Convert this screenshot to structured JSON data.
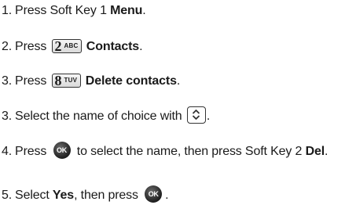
{
  "steps": [
    {
      "num": "1.",
      "pre": "Press Soft Key 1 ",
      "bold": "Menu",
      "post": "."
    },
    {
      "num": "2.",
      "pre": "Press ",
      "key_big": "2",
      "key_small": "ABC",
      "bold": "Contacts",
      "post": "."
    },
    {
      "num": "3.",
      "pre": "Press ",
      "key_big": "8",
      "key_small": "TUV",
      "bold": "Delete contacts",
      "post": "."
    },
    {
      "num": "3.",
      "pre": "Select the name of choice with ",
      "post": "."
    },
    {
      "num": "4.",
      "pre": "Press ",
      "mid": "to select the name, then press Soft Key 2 ",
      "bold": "Del",
      "post": "."
    },
    {
      "num": "5.",
      "pre": "Select ",
      "bold": "Yes",
      "mid": ", then press ",
      "post": "."
    }
  ],
  "icons": {
    "ok_label": "OK",
    "key_2": "2-abc-key-icon",
    "key_8": "8-tuv-key-icon",
    "nav": "navigation-key-icon",
    "ok": "ok-key-icon"
  }
}
